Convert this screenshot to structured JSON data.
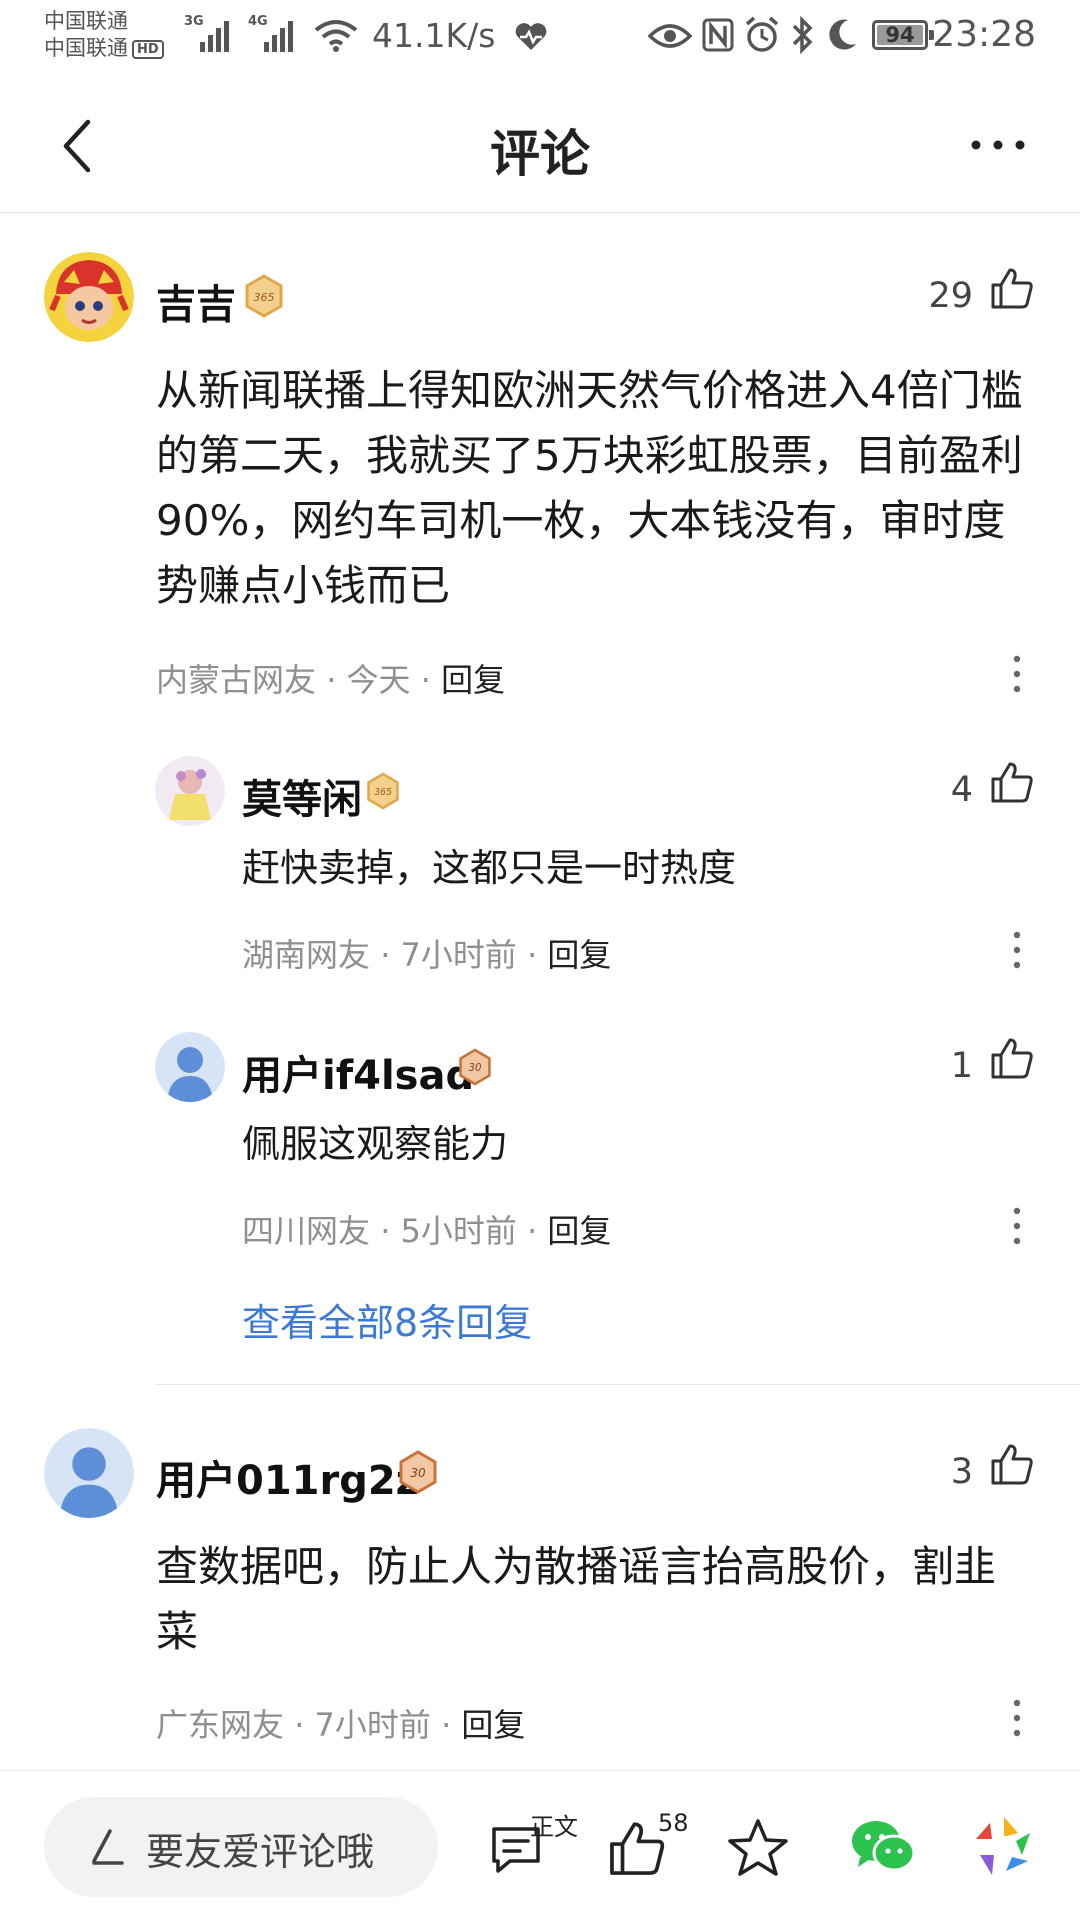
{
  "status_bar": {
    "carrier1": "中国联通",
    "carrier2": "中国联通",
    "hd": "HD",
    "net1": "3G",
    "net2": "4G",
    "speed": "41.1K/s",
    "battery": "94",
    "time": "23:28"
  },
  "header": {
    "title": "评论",
    "back_icon": "chevron-left-icon",
    "more_icon": "more-horizontal-icon"
  },
  "comments": [
    {
      "user": "吉吉",
      "badge": "365",
      "likes": "29",
      "text": "从新闻联播上得知欧洲天然气价格进入4倍门槛的第二天，我就买了5万块彩虹股票，目前盈利90%，网约车司机一枚，大本钱没有，审时度势赚点小钱而已",
      "location": "内蒙古网友",
      "time": "今天",
      "reply": "回复",
      "replies": [
        {
          "user": "莫等闲",
          "badge": "365",
          "likes": "4",
          "text": "赶快卖掉，这都只是一时热度",
          "location": "湖南网友",
          "time": "7小时前",
          "reply": "回复"
        },
        {
          "user": "用户if4lsad",
          "badge": "30",
          "likes": "1",
          "text": "佩服这观察能力",
          "location": "四川网友",
          "time": "5小时前",
          "reply": "回复"
        }
      ],
      "view_all": "查看全部8条回复"
    },
    {
      "user": "用户011rg2z",
      "badge": "30",
      "likes": "3",
      "text": "查数据吧，防止人为散播谣言抬高股价，割韭菜",
      "location": "广东网友",
      "time": "7小时前",
      "reply": "回复"
    }
  ],
  "meta_sep": "·",
  "bottom_bar": {
    "placeholder": "要友爱评论哦",
    "zhengwen_label": "正文",
    "like_count": "58"
  },
  "colors": {
    "link": "#3d7ad8",
    "meta": "#8f8f8f",
    "badge_gold": "#e0a84a",
    "badge_bronze": "#c8733a"
  }
}
